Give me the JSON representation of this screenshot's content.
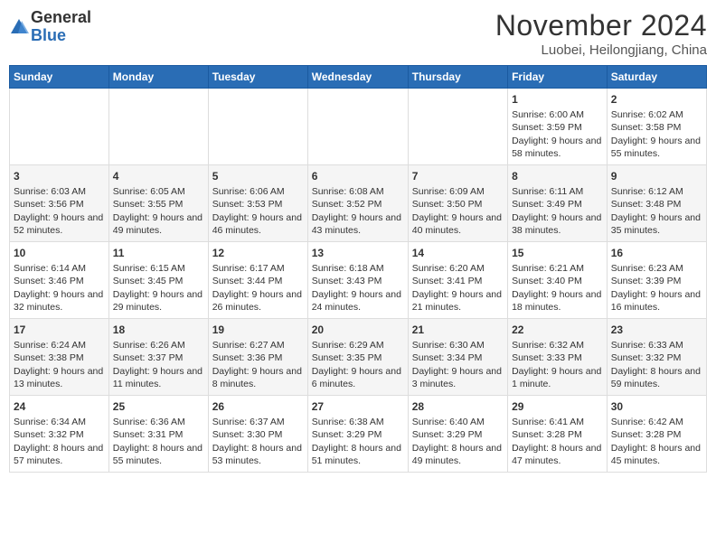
{
  "logo": {
    "general": "General",
    "blue": "Blue"
  },
  "title": {
    "month_year": "November 2024",
    "location": "Luobei, Heilongjiang, China"
  },
  "weekdays": [
    "Sunday",
    "Monday",
    "Tuesday",
    "Wednesday",
    "Thursday",
    "Friday",
    "Saturday"
  ],
  "weeks": [
    [
      {
        "day": "",
        "detail": ""
      },
      {
        "day": "",
        "detail": ""
      },
      {
        "day": "",
        "detail": ""
      },
      {
        "day": "",
        "detail": ""
      },
      {
        "day": "",
        "detail": ""
      },
      {
        "day": "1",
        "detail": "Sunrise: 6:00 AM\nSunset: 3:59 PM\nDaylight: 9 hours and 58 minutes."
      },
      {
        "day": "2",
        "detail": "Sunrise: 6:02 AM\nSunset: 3:58 PM\nDaylight: 9 hours and 55 minutes."
      }
    ],
    [
      {
        "day": "3",
        "detail": "Sunrise: 6:03 AM\nSunset: 3:56 PM\nDaylight: 9 hours and 52 minutes."
      },
      {
        "day": "4",
        "detail": "Sunrise: 6:05 AM\nSunset: 3:55 PM\nDaylight: 9 hours and 49 minutes."
      },
      {
        "day": "5",
        "detail": "Sunrise: 6:06 AM\nSunset: 3:53 PM\nDaylight: 9 hours and 46 minutes."
      },
      {
        "day": "6",
        "detail": "Sunrise: 6:08 AM\nSunset: 3:52 PM\nDaylight: 9 hours and 43 minutes."
      },
      {
        "day": "7",
        "detail": "Sunrise: 6:09 AM\nSunset: 3:50 PM\nDaylight: 9 hours and 40 minutes."
      },
      {
        "day": "8",
        "detail": "Sunrise: 6:11 AM\nSunset: 3:49 PM\nDaylight: 9 hours and 38 minutes."
      },
      {
        "day": "9",
        "detail": "Sunrise: 6:12 AM\nSunset: 3:48 PM\nDaylight: 9 hours and 35 minutes."
      }
    ],
    [
      {
        "day": "10",
        "detail": "Sunrise: 6:14 AM\nSunset: 3:46 PM\nDaylight: 9 hours and 32 minutes."
      },
      {
        "day": "11",
        "detail": "Sunrise: 6:15 AM\nSunset: 3:45 PM\nDaylight: 9 hours and 29 minutes."
      },
      {
        "day": "12",
        "detail": "Sunrise: 6:17 AM\nSunset: 3:44 PM\nDaylight: 9 hours and 26 minutes."
      },
      {
        "day": "13",
        "detail": "Sunrise: 6:18 AM\nSunset: 3:43 PM\nDaylight: 9 hours and 24 minutes."
      },
      {
        "day": "14",
        "detail": "Sunrise: 6:20 AM\nSunset: 3:41 PM\nDaylight: 9 hours and 21 minutes."
      },
      {
        "day": "15",
        "detail": "Sunrise: 6:21 AM\nSunset: 3:40 PM\nDaylight: 9 hours and 18 minutes."
      },
      {
        "day": "16",
        "detail": "Sunrise: 6:23 AM\nSunset: 3:39 PM\nDaylight: 9 hours and 16 minutes."
      }
    ],
    [
      {
        "day": "17",
        "detail": "Sunrise: 6:24 AM\nSunset: 3:38 PM\nDaylight: 9 hours and 13 minutes."
      },
      {
        "day": "18",
        "detail": "Sunrise: 6:26 AM\nSunset: 3:37 PM\nDaylight: 9 hours and 11 minutes."
      },
      {
        "day": "19",
        "detail": "Sunrise: 6:27 AM\nSunset: 3:36 PM\nDaylight: 9 hours and 8 minutes."
      },
      {
        "day": "20",
        "detail": "Sunrise: 6:29 AM\nSunset: 3:35 PM\nDaylight: 9 hours and 6 minutes."
      },
      {
        "day": "21",
        "detail": "Sunrise: 6:30 AM\nSunset: 3:34 PM\nDaylight: 9 hours and 3 minutes."
      },
      {
        "day": "22",
        "detail": "Sunrise: 6:32 AM\nSunset: 3:33 PM\nDaylight: 9 hours and 1 minute."
      },
      {
        "day": "23",
        "detail": "Sunrise: 6:33 AM\nSunset: 3:32 PM\nDaylight: 8 hours and 59 minutes."
      }
    ],
    [
      {
        "day": "24",
        "detail": "Sunrise: 6:34 AM\nSunset: 3:32 PM\nDaylight: 8 hours and 57 minutes."
      },
      {
        "day": "25",
        "detail": "Sunrise: 6:36 AM\nSunset: 3:31 PM\nDaylight: 8 hours and 55 minutes."
      },
      {
        "day": "26",
        "detail": "Sunrise: 6:37 AM\nSunset: 3:30 PM\nDaylight: 8 hours and 53 minutes."
      },
      {
        "day": "27",
        "detail": "Sunrise: 6:38 AM\nSunset: 3:29 PM\nDaylight: 8 hours and 51 minutes."
      },
      {
        "day": "28",
        "detail": "Sunrise: 6:40 AM\nSunset: 3:29 PM\nDaylight: 8 hours and 49 minutes."
      },
      {
        "day": "29",
        "detail": "Sunrise: 6:41 AM\nSunset: 3:28 PM\nDaylight: 8 hours and 47 minutes."
      },
      {
        "day": "30",
        "detail": "Sunrise: 6:42 AM\nSunset: 3:28 PM\nDaylight: 8 hours and 45 minutes."
      }
    ]
  ]
}
